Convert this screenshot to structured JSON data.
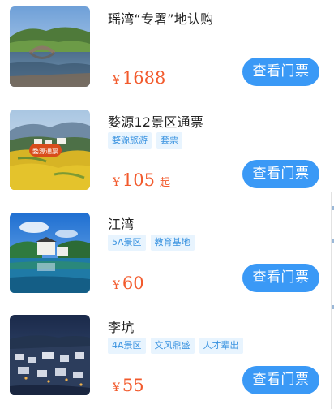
{
  "items": [
    {
      "title": "瑶湾“专署”地认购",
      "tags": [],
      "currency": "¥",
      "price": "1688",
      "price_suffix": "",
      "button_label": "查看门票",
      "image_icon": "lake-bridge-photo"
    },
    {
      "title": "婺源12景区通票",
      "tags": [
        "婺源旅游",
        "套票"
      ],
      "currency": "¥",
      "price": "105",
      "price_suffix": "起",
      "button_label": "查看门票",
      "image_icon": "rapeseed-village-photo",
      "image_badge": "婺源通票"
    },
    {
      "title": "江湾",
      "tags": [
        "5A景区",
        "教育基地"
      ],
      "currency": "¥",
      "price": "60",
      "price_suffix": "",
      "button_label": "查看门票",
      "image_icon": "pond-village-photo"
    },
    {
      "title": "李坑",
      "tags": [
        "4A景区",
        "文风鼎盛",
        "人才辈出"
      ],
      "currency": "¥",
      "price": "55",
      "price_suffix": "",
      "button_label": "查看门票",
      "image_icon": "night-village-photo"
    }
  ],
  "colors": {
    "accent": "#3a99f6",
    "price": "#f25a2c",
    "tag_bg": "#e8f4fe",
    "tag_text": "#3a93e0"
  }
}
